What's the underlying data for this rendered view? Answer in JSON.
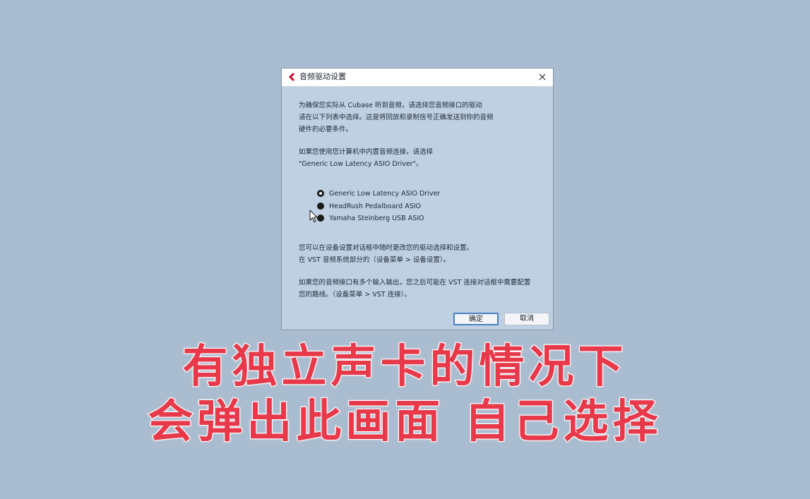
{
  "dialog": {
    "title": "音频驱动设置",
    "logo_icon": "cubase-logo-icon",
    "close_icon": "close-icon",
    "paragraphs": [
      "为确保您实际从 Cubase 听到音频，请选择您音频接口的驱动\n请在以下列表中选择。这是将回放和录制信号正确发送到你的音频\n硬件的必要条件。",
      "如果您使用您计算机中内置音频连接，请选择\n\"Generic Low Latency ASIO Driver\"。"
    ],
    "drivers": [
      {
        "label": "Generic Low Latency ASIO Driver",
        "selected": true
      },
      {
        "label": "HeadRush Pedalboard ASIO",
        "selected": false
      },
      {
        "label": "Yamaha Steinberg USB ASIO",
        "selected": false
      }
    ],
    "bottom_paragraphs": [
      "您可以在设备设置对话框中随时更改您的驱动选择和设置。\n在 VST 音频系统部分的（设备菜单 > 设备设置）。",
      "如果您的音频接口有多个输入输出，您之后可能在 VST 连接对话框中需要配置\n您的路线。（设备菜单 > VST 连接）。"
    ],
    "ok_label": "确定",
    "cancel_label": "取消",
    "accent_color": "#4a7fc5",
    "logo_color": "#c8102e"
  },
  "captions": {
    "line1": "有独立声卡的情况下",
    "line2": "会弹出此画面 自己选择",
    "color": "#e8394a"
  },
  "pointer_icon": "mouse-cursor-icon"
}
